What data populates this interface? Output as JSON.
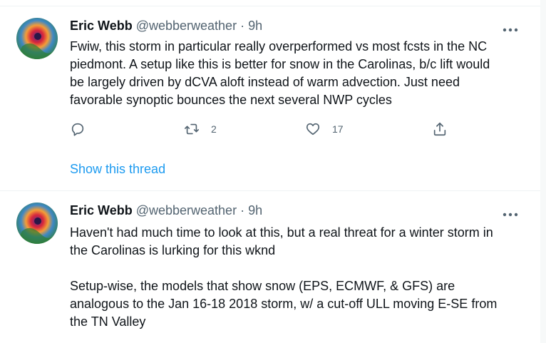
{
  "tweets": [
    {
      "name": "Eric Webb",
      "handle": "@webberweather",
      "separator": "·",
      "time": "9h",
      "text": "Fwiw, this storm in particular really overperformed vs most fcsts in the NC\npiedmont. A setup like this is better for snow in the Carolinas, b/c lift would\nbe largely driven by dCVA aloft instead of warm advection. Just need\nfavorable synoptic bounces the next several NWP cycles",
      "retweets": "2",
      "likes": "17",
      "show_thread": "Show this thread"
    },
    {
      "name": "Eric Webb",
      "handle": "@webberweather",
      "separator": "·",
      "time": "9h",
      "text": "Haven't had much time to look at this, but a real threat for a winter storm in\nthe Carolinas is lurking for this wknd\n\nSetup-wise, the models that show snow (EPS, ECMWF, & GFS) are\nanalogous to the Jan 16-18 2018 storm, w/ a cut-off ULL moving E-SE from\nthe TN Valley"
    }
  ],
  "icons": {
    "reply": "reply-icon",
    "retweet": "retweet-icon",
    "like": "like-icon",
    "share": "share-icon",
    "more": "more-icon"
  },
  "colors": {
    "link": "#1d9bf0",
    "secondary": "#536471"
  }
}
